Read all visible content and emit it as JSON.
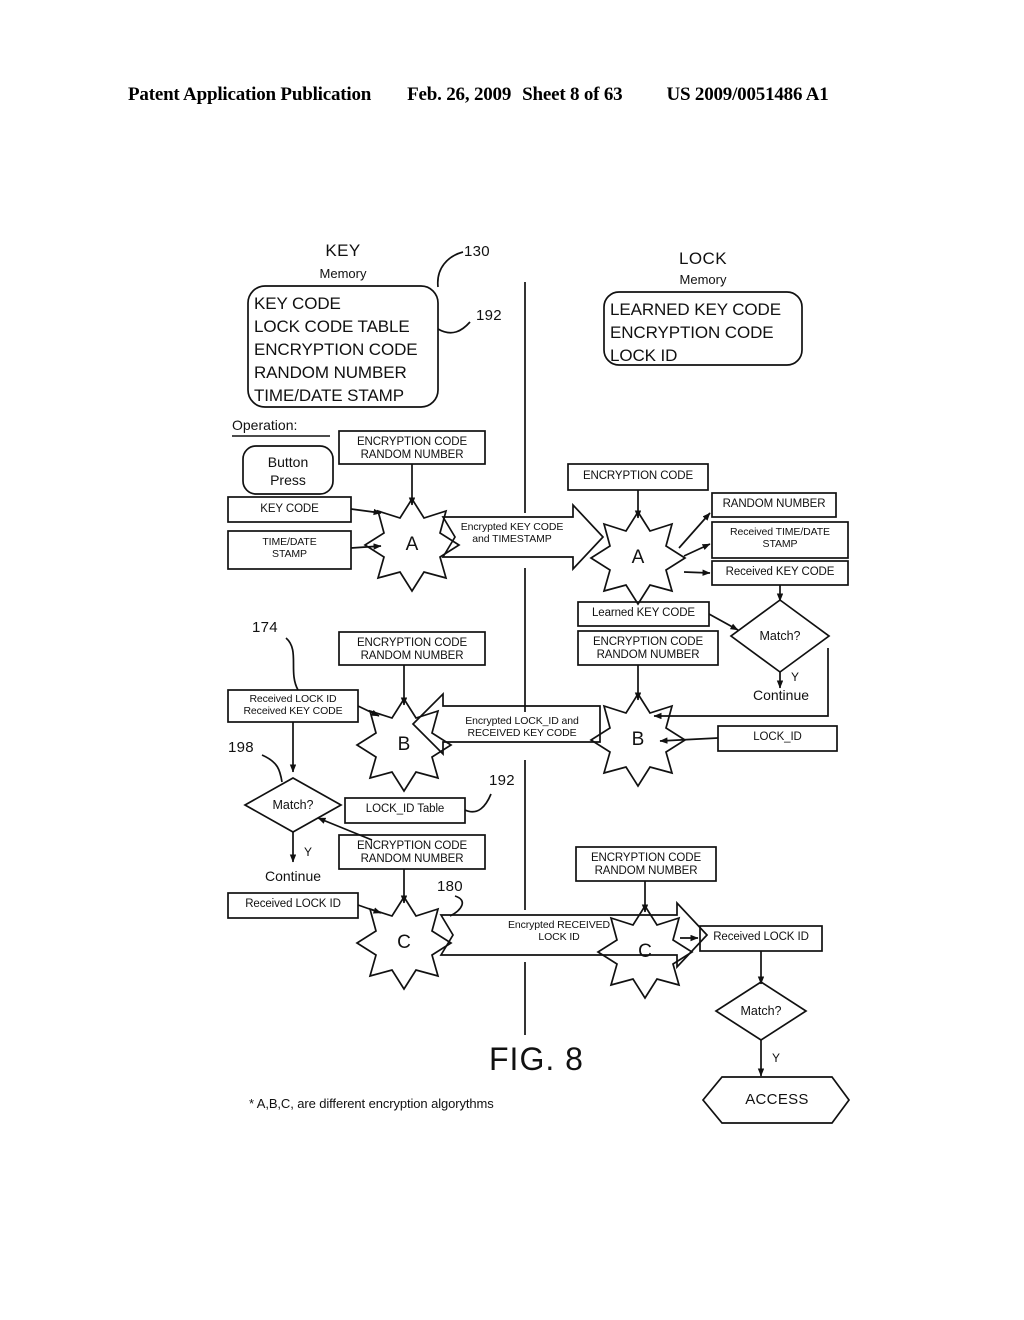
{
  "header": {
    "publication": "Patent Application Publication",
    "date": "Feb. 26, 2009",
    "sheet": "Sheet 8 of 63",
    "patent_number": "US 2009/0051486 A1"
  },
  "figure": {
    "caption": "FIG. 8",
    "footnote": "* A,B,C, are different encryption algorythms",
    "operation_label": "Operation:"
  },
  "key_side": {
    "title": "KEY",
    "subtitle": "Memory",
    "memory_items": [
      "KEY CODE",
      "LOCK CODE TABLE",
      "ENCRYPTION CODE",
      "RANDOM NUMBER",
      "TIME/DATE STAMP"
    ],
    "ref_130": "130",
    "ref_192_top": "192",
    "button_press": "Button\nPress",
    "enc_rand_a": "ENCRYPTION CODE\nRANDOM NUMBER",
    "key_code_box": "KEY CODE",
    "time_date_box": "TIME/DATE\nSTAMP",
    "star_a": "A",
    "ref_174": "174",
    "enc_rand_b": "ENCRYPTION CODE\nRANDOM NUMBER",
    "received_lock_key": "Received LOCK ID\nReceived KEY CODE",
    "ref_198": "198",
    "star_b": "B",
    "match_b": "Match?",
    "yes_b": "Y",
    "continue_b": "Continue",
    "lock_id_table": "LOCK_ID Table",
    "ref_192_mid": "192",
    "enc_rand_c": "ENCRYPTION CODE\nRANDOM NUMBER",
    "received_lock_id": "Received LOCK ID",
    "ref_180": "180",
    "star_c": "C"
  },
  "lock_side": {
    "title": "LOCK",
    "subtitle": "Memory",
    "memory_items": [
      "LEARNED KEY CODE",
      "ENCRYPTION CODE",
      "LOCK ID"
    ],
    "encryption_code": "ENCRYPTION CODE",
    "star_a": "A",
    "random_number": "RANDOM NUMBER",
    "received_time_date": "Received TIME/DATE\nSTAMP",
    "received_key_code": "Received KEY CODE",
    "learned_key_code": "Learned KEY CODE",
    "match_a": "Match?",
    "yes_a": "Y",
    "continue_a": "Continue",
    "enc_rand_b": "ENCRYPTION CODE\nRANDOM NUMBER",
    "star_b": "B",
    "lock_id": "LOCK_ID",
    "enc_rand_c": "ENCRYPTION CODE\nRANDOM NUMBER",
    "star_c": "C",
    "received_lock_id": "Received LOCK ID",
    "match_c": "Match?",
    "yes_c": "Y",
    "access": "ACCESS"
  },
  "transfers": {
    "a_to_a": "Encrypted KEY CODE\nand TIMESTAMP",
    "b_to_b": "Encrypted LOCK_ID and\nRECEIVED KEY CODE",
    "c_to_c": "Encrypted RECEIVED\nLOCK ID"
  },
  "colors": {
    "ink": "#111111",
    "paper": "#ffffff"
  }
}
